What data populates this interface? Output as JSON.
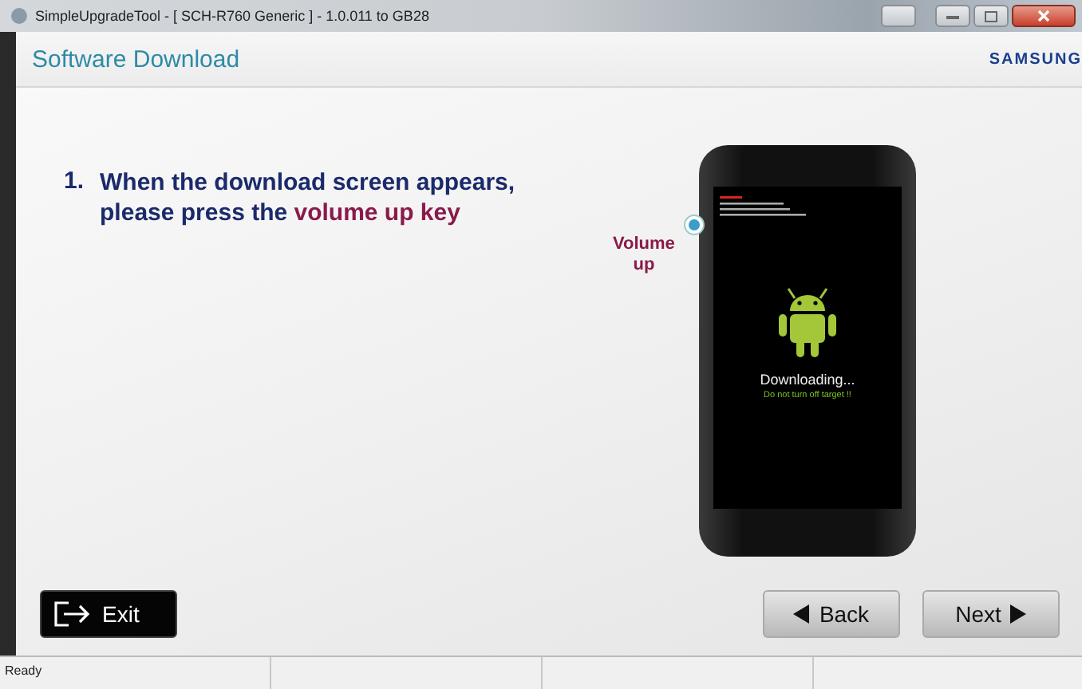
{
  "window": {
    "title": "SimpleUpgradeTool - [ SCH-R760 Generic ] - 1.0.011 to GB28"
  },
  "header": {
    "title": "Software Download",
    "brand": "SAMSUNG"
  },
  "instruction": {
    "number": "1.",
    "text": "When the download screen appears,\nplease press the ",
    "highlight": "volume up key"
  },
  "phone": {
    "callout": "Volume\nup",
    "status": "Downloading...",
    "warning": "Do not turn off target !!"
  },
  "buttons": [
    {
      "kind": "exit",
      "label": "Exit"
    },
    {
      "kind": "back",
      "label": "Back"
    },
    {
      "kind": "next",
      "label": "Next"
    }
  ],
  "status_bar": [
    "Ready"
  ]
}
